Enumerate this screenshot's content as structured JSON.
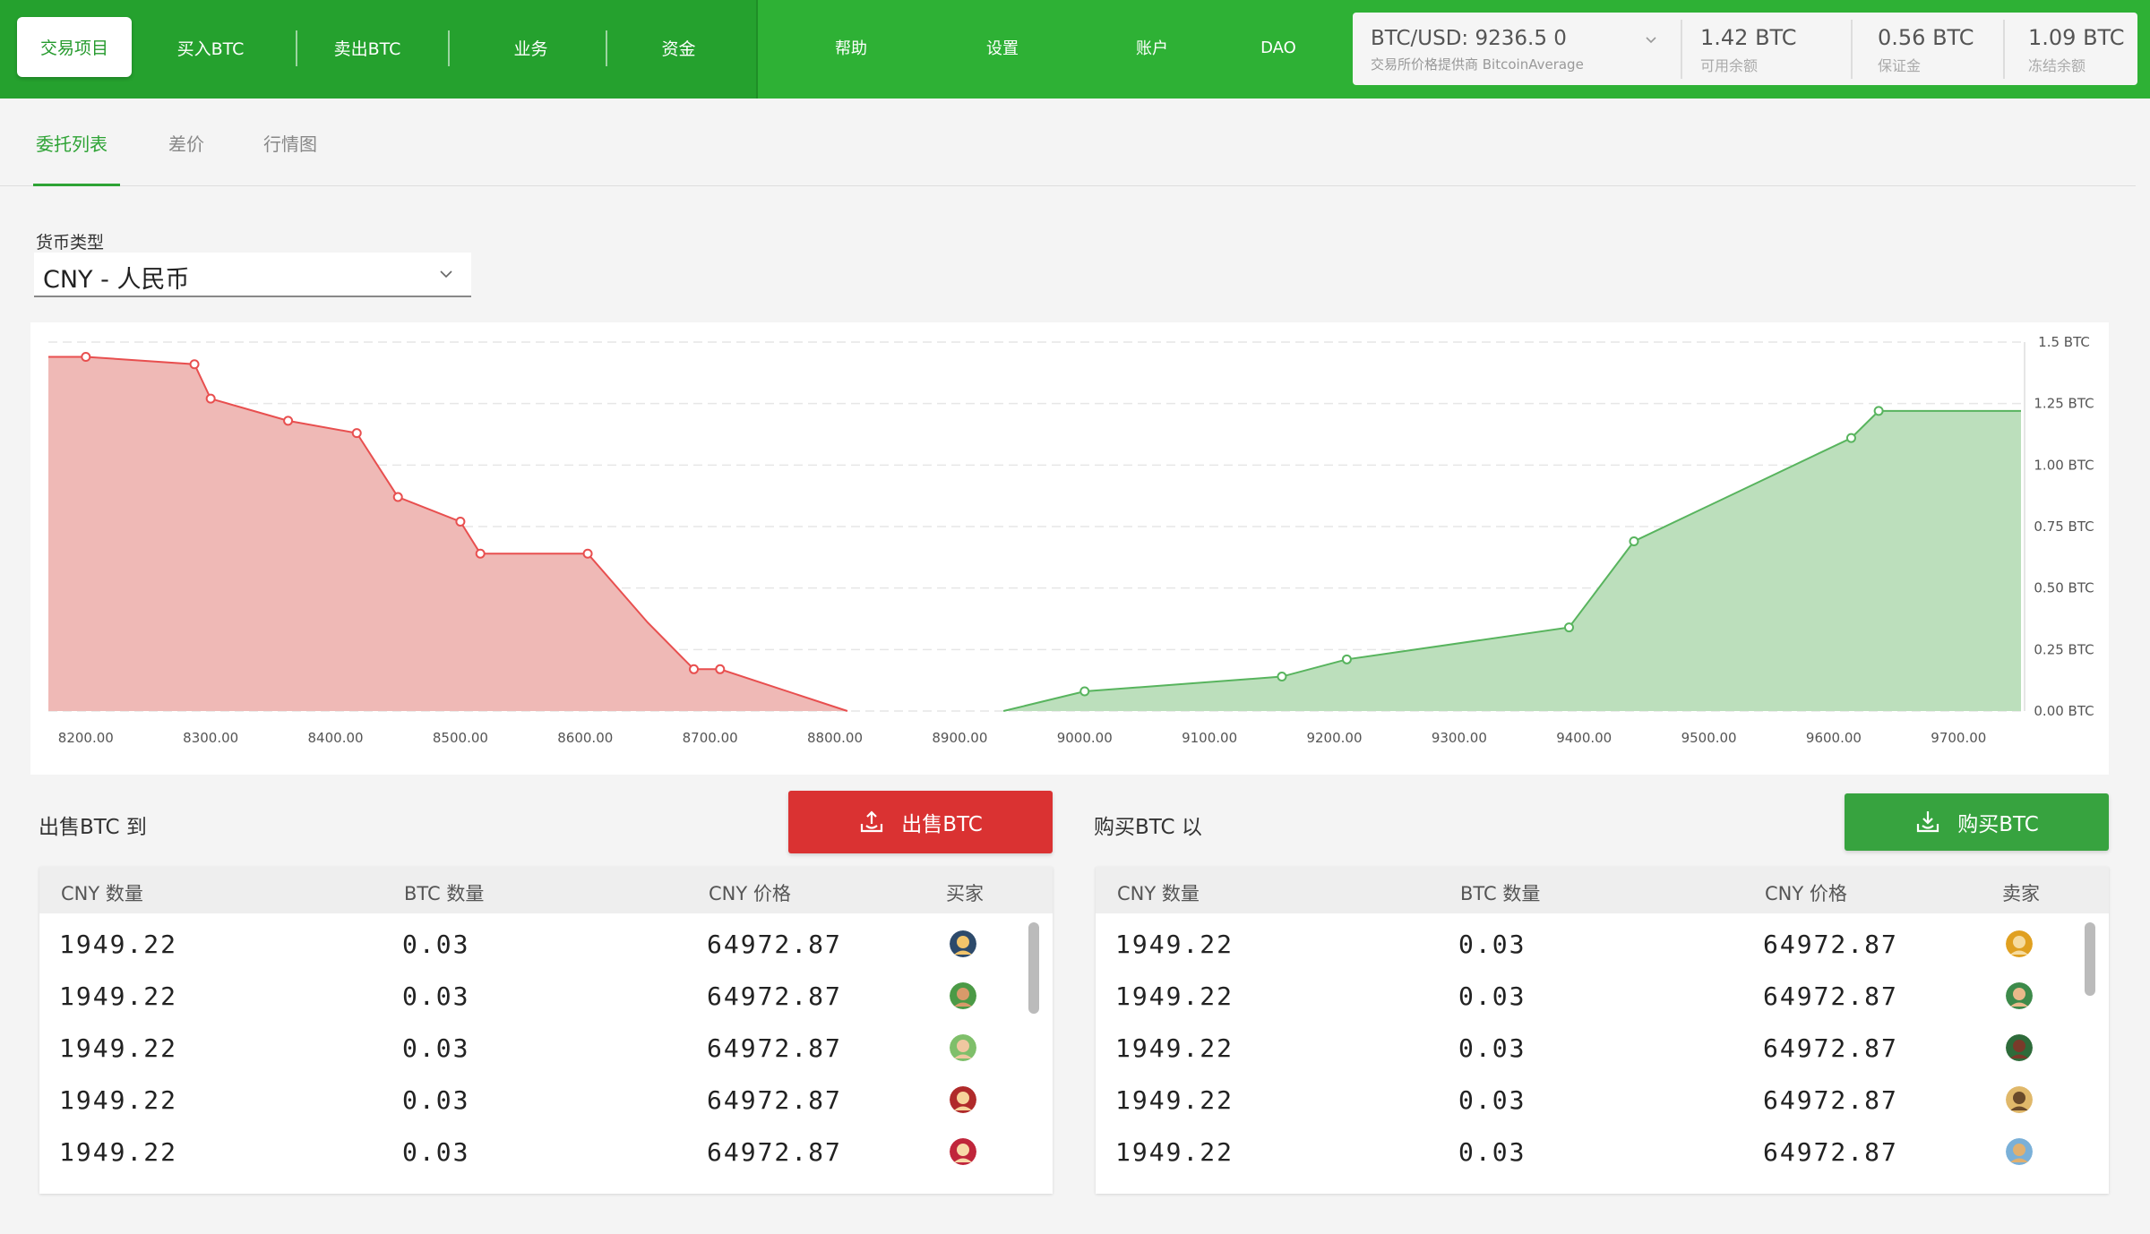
{
  "nav": {
    "items": [
      "交易项目",
      "买入BTC",
      "卖出BTC",
      "业务",
      "资金"
    ],
    "right_items": [
      "帮助",
      "设置",
      "账户",
      "DAO"
    ]
  },
  "ticker": {
    "price": "BTC/USD: 9236.5 0",
    "source": "交易所价格提供商 BitcoinAverage",
    "balances": [
      {
        "value": "1.42 BTC",
        "label": "可用余额"
      },
      {
        "value": "0.56 BTC",
        "label": "保证金"
      },
      {
        "value": "1.09 BTC",
        "label": "冻结余额"
      }
    ]
  },
  "tabs": [
    "委托列表",
    "差价",
    "行情图"
  ],
  "currency": {
    "label": "货币类型",
    "value": "CNY - 人民币"
  },
  "chart_data": {
    "type": "area",
    "x_ticks": [
      "8200.00",
      "8300.00",
      "8400.00",
      "8500.00",
      "8600.00",
      "8700.00",
      "8800.00",
      "8900.00",
      "9000.00",
      "9100.00",
      "9200.00",
      "9300.00",
      "9400.00",
      "9500.00",
      "9600.00",
      "9700.00"
    ],
    "y_ticks": [
      "0.00 BTC",
      "0.25 BTC",
      "0.50 BTC",
      "0.75 BTC",
      "1.00 BTC",
      "1.25 BTC",
      "1.5 BTC"
    ],
    "xlim": [
      8170,
      9750
    ],
    "ylim": [
      0,
      1.5
    ],
    "grid": true,
    "series": [
      {
        "color": "#e84f4f",
        "fill": "#efb9b6",
        "x": [
          8170,
          8200,
          8287,
          8300,
          8362,
          8417,
          8450,
          8500,
          8516,
          8602,
          8650,
          8687,
          8708,
          8810
        ],
        "y": [
          1.44,
          1.44,
          1.41,
          1.27,
          1.18,
          1.13,
          0.87,
          0.77,
          0.64,
          0.64,
          0.36,
          0.17,
          0.17,
          0
        ],
        "markers": [
          false,
          true,
          true,
          true,
          true,
          true,
          true,
          true,
          true,
          true,
          false,
          true,
          true,
          false
        ]
      },
      {
        "color": "#58b45e",
        "fill": "#bcdfbc",
        "x": [
          8935,
          9000,
          9158,
          9210,
          9388,
          9440,
          9614,
          9636,
          9750
        ],
        "y": [
          0,
          0.08,
          0.14,
          0.21,
          0.34,
          0.69,
          1.11,
          1.22,
          1.22
        ],
        "markers": [
          false,
          true,
          true,
          true,
          true,
          true,
          true,
          true,
          false
        ]
      }
    ]
  },
  "sell": {
    "title": "出售BTC  到",
    "button": "出售BTC",
    "headers": [
      "CNY 数量",
      "BTC 数量",
      "CNY  价格",
      "买家"
    ],
    "rows": [
      {
        "cny": "1949.22",
        "btc": "0.03",
        "price": "64972.87"
      },
      {
        "cny": "1949.22",
        "btc": "0.03",
        "price": "64972.87"
      },
      {
        "cny": "1949.22",
        "btc": "0.03",
        "price": "64972.87"
      },
      {
        "cny": "1949.22",
        "btc": "0.03",
        "price": "64972.87"
      },
      {
        "cny": "1949.22",
        "btc": "0.03",
        "price": "64972.87"
      }
    ]
  },
  "buy": {
    "title": "购买BTC  以",
    "button": "购买BTC",
    "headers": [
      "CNY 数量",
      "BTC 数量",
      "CNY 价格",
      "卖家"
    ],
    "rows": [
      {
        "cny": "1949.22",
        "btc": "0.03",
        "price": "64972.87"
      },
      {
        "cny": "1949.22",
        "btc": "0.03",
        "price": "64972.87"
      },
      {
        "cny": "1949.22",
        "btc": "0.03",
        "price": "64972.87"
      },
      {
        "cny": "1949.22",
        "btc": "0.03",
        "price": "64972.87"
      },
      {
        "cny": "1949.22",
        "btc": "0.03",
        "price": "64972.87"
      }
    ]
  }
}
